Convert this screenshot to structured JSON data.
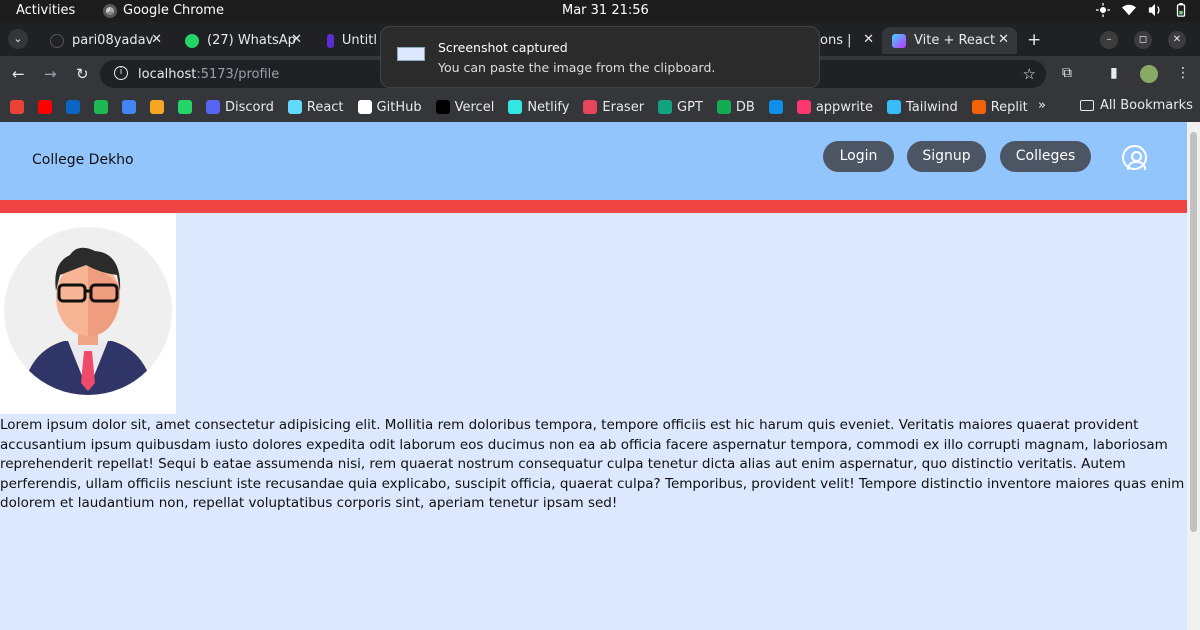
{
  "os_bar": {
    "activities": "Activities",
    "app_name": "Google Chrome",
    "datetime": "Mar 31  21:56"
  },
  "tabs": [
    {
      "label": "pari08yadav",
      "icon": "github-icon"
    },
    {
      "label": "(27) WhatsAp",
      "icon": "whatsapp-icon"
    },
    {
      "label": "Untitl",
      "icon": "arc-icon"
    },
    {
      "label": "ons |",
      "icon": "page-icon"
    },
    {
      "label": "Vite + React",
      "icon": "vite-icon",
      "active": true
    }
  ],
  "toolbar": {
    "url_host": "localhost",
    "url_path": ":5173/profile"
  },
  "bookmarks": {
    "items": [
      {
        "label": "",
        "icon": "gmail-icon",
        "color": "#ea4335"
      },
      {
        "label": "",
        "icon": "youtube-icon",
        "color": "#ff0000"
      },
      {
        "label": "",
        "icon": "linkedin-icon",
        "color": "#0a66c2"
      },
      {
        "label": "",
        "icon": "spotify-icon",
        "color": "#1db954"
      },
      {
        "label": "",
        "icon": "docs-icon",
        "color": "#4285f4"
      },
      {
        "label": "",
        "icon": "mt-icon",
        "color": "#f5a623"
      },
      {
        "label": "",
        "icon": "whatsapp-icon",
        "color": "#25d366"
      },
      {
        "label": "Discord",
        "icon": "discord-icon",
        "color": "#5865f2"
      },
      {
        "label": "React",
        "icon": "react-icon",
        "color": "#61dafb"
      },
      {
        "label": "GitHub",
        "icon": "github-icon",
        "color": "#ffffff"
      },
      {
        "label": "Vercel",
        "icon": "vercel-icon",
        "color": "#000000"
      },
      {
        "label": "Netlify",
        "icon": "netlify-icon",
        "color": "#32e6e2"
      },
      {
        "label": "Eraser",
        "icon": "eraser-icon",
        "color": "#e8455a"
      },
      {
        "label": "GPT",
        "icon": "chatgpt-icon",
        "color": "#10a37f"
      },
      {
        "label": "DB",
        "icon": "mongodb-icon",
        "color": "#13aa52"
      },
      {
        "label": "",
        "icon": "is-icon",
        "color": "#0e8ee9"
      },
      {
        "label": "appwrite",
        "icon": "appwrite-icon",
        "color": "#fd366e"
      },
      {
        "label": "Tailwind",
        "icon": "tailwind-icon",
        "color": "#38bdf8"
      },
      {
        "label": "Replit",
        "icon": "replit-icon",
        "color": "#f26207"
      }
    ],
    "more": "»",
    "all_bookmarks": "All Bookmarks"
  },
  "toast": {
    "title": "Screenshot captured",
    "message": "You can paste the image from the clipboard."
  },
  "site": {
    "brand": "College Dekho",
    "nav": {
      "login": "Login",
      "signup": "Signup",
      "colleges": "Colleges"
    },
    "colors": {
      "nav_bg": "#93c5fd",
      "stripe": "#ef4444",
      "page_bg": "#dbe8fd",
      "pill_bg": "#4b5563"
    },
    "profile_text": "Lorem ipsum dolor sit, amet consectetur adipisicing elit. Mollitia rem doloribus tempora, tempore officiis est hic harum quis eveniet. Veritatis maiores quaerat provident accusantium ipsum quibusdam iusto dolores expedita odit laborum eos ducimus non ea ab officia facere aspernatur tempora, commodi ex illo corrupti magnam, laboriosam reprehenderit repellat! Sequi b eatae assumenda nisi, rem quaerat nostrum consequatur culpa tenetur dicta alias aut enim aspernatur, quo distinctio veritatis. Autem perferendis, ullam officiis nesciunt iste recusandae quia explicabo, suscipit officia, quaerat culpa? Temporibus, provident velit! Tempore distinctio inventore maiores quas enim dolorem et laudantium non, repellat voluptatibus corporis sint, aperiam tenetur ipsam sed!"
  }
}
